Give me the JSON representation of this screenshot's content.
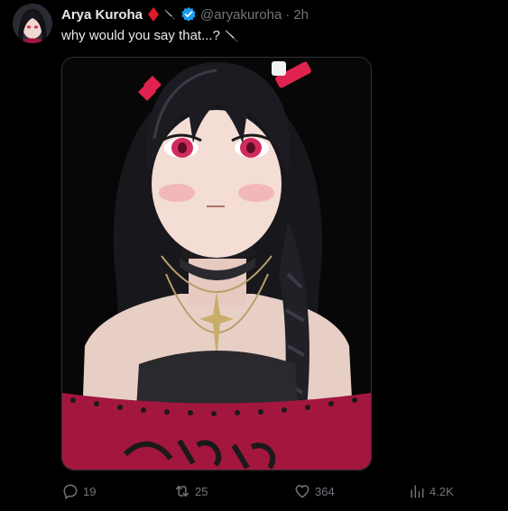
{
  "post": {
    "author": {
      "display_name": "Arya Kuroha",
      "handle": "@aryakuroha",
      "verified": true,
      "name_emojis": [
        "red-diamond",
        "knife"
      ]
    },
    "separator": "·",
    "time": "2h",
    "text": "why would you say that...?",
    "text_emoji": "knife",
    "media": {
      "description_icon": "anime-girl-portrait"
    },
    "actions": {
      "replies": "19",
      "reposts": "25",
      "likes": "364",
      "views": "4.2K"
    }
  },
  "colors": {
    "background": "#000000",
    "primary_text": "#e7e9ea",
    "secondary_text": "#71767b",
    "verified_blue": "#1d9bf0",
    "diamond_red": "#e0182b",
    "media_border": "#2f3336"
  }
}
